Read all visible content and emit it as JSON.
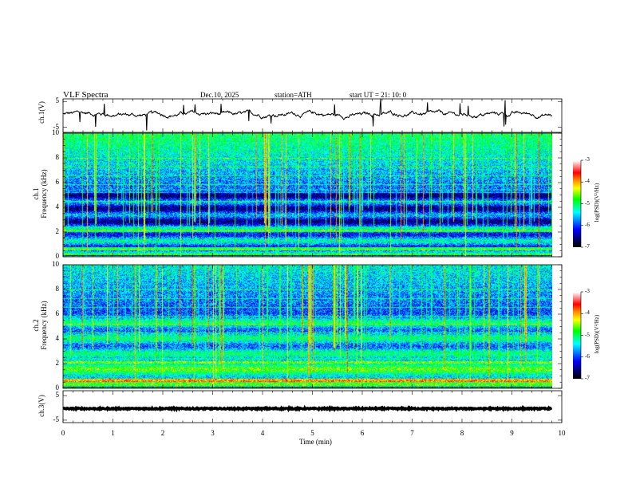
{
  "header": {
    "title": "VLF  Spectra",
    "date": "Dec.10, 2025",
    "station": "station=ATH",
    "start": "start  UT  =    21: 10: 0"
  },
  "chart_data": [
    {
      "type": "line",
      "ylabel": "ch.1(V)",
      "yticks": [
        "5",
        "-5"
      ],
      "ylim": [
        -7,
        6
      ],
      "xlim": [
        0,
        10
      ],
      "color": "#000000"
    },
    {
      "type": "heatmap",
      "ylabel": "ch.1\nFrequency (kHz)",
      "ylabel_lines": [
        "ch.1",
        "Frequency (kHz)"
      ],
      "yticks": [
        "0",
        "2",
        "4",
        "6",
        "8",
        "10"
      ],
      "ylim": [
        0,
        10
      ],
      "xlim": [
        0,
        10
      ],
      "data_end_min": 9.8,
      "colorbar": {
        "label": "log(PSD)(V²/Hz)",
        "ticks": [
          "-3",
          "-4",
          "-5",
          "-6",
          "-7"
        ],
        "range": [
          -7,
          -3
        ]
      },
      "colormap": [
        "#000000",
        "#0000ff",
        "#00ffff",
        "#00ff00",
        "#ffff00",
        "#ff8000",
        "#ff0000",
        "#ffffff"
      ]
    },
    {
      "type": "heatmap",
      "ylabel_lines": [
        "ch.2",
        "Frequency (kHz)"
      ],
      "yticks": [
        "0",
        "2",
        "4",
        "6",
        "8",
        "10"
      ],
      "ylim": [
        0,
        10
      ],
      "xlim": [
        0,
        10
      ],
      "data_end_min": 9.8,
      "colorbar": {
        "label": "log(PSD)(V²/Hz)",
        "ticks": [
          "-3",
          "-4",
          "-5",
          "-6",
          "-7"
        ],
        "range": [
          -7,
          -3
        ]
      }
    },
    {
      "type": "line",
      "ylabel": "ch.3(V)",
      "yticks": [
        "5",
        "-5"
      ],
      "ylim": [
        -6,
        7
      ],
      "xlim": [
        0,
        10
      ],
      "color": "#000000"
    }
  ],
  "xaxis": {
    "label": "Time  (min)",
    "ticks": [
      "0",
      "1",
      "2",
      "3",
      "4",
      "5",
      "6",
      "7",
      "8",
      "9",
      "10"
    ]
  }
}
